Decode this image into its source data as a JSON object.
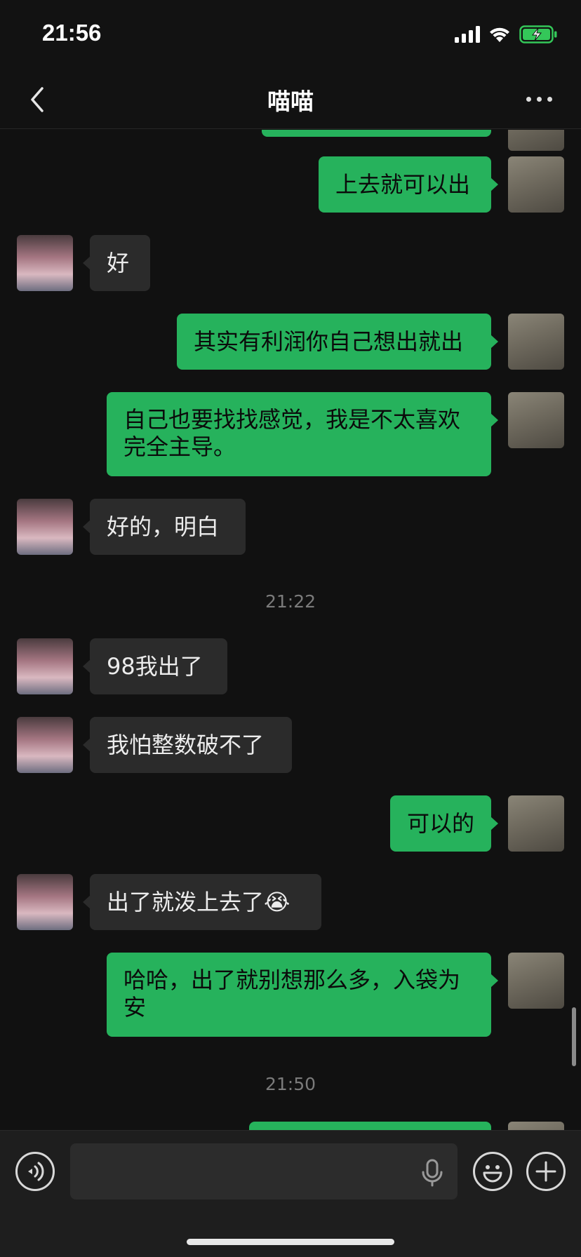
{
  "status_bar": {
    "time": "21:56",
    "battery_charging": true
  },
  "header": {
    "title": "喵喵"
  },
  "timestamps": {
    "t1": "21:22",
    "t2": "21:50"
  },
  "messages": {
    "m1": "上去就可以出",
    "m2": "好",
    "m3": "其实有利润你自己想出就出",
    "m4_line1": "自己也要找找感觉，我是不太喜欢",
    "m4_line2": "完全主导。",
    "m5": "好的，明白",
    "m6": "98我出了",
    "m7": "我怕整数破不了",
    "m8": "可以的",
    "m9": "出了就泼上去了",
    "m9_emoji": "😭",
    "m10_line1": "哈哈，出了就别想那么多，入袋为",
    "m10_line2": "安"
  },
  "input": {
    "placeholder": "",
    "value": ""
  },
  "colors": {
    "accent": "#26b25c",
    "background": "#111111",
    "incoming_bubble": "#2b2b2b"
  },
  "icons": [
    "chevron-left-icon",
    "more-icon",
    "signal-icon",
    "wifi-icon",
    "battery-icon",
    "voice-icon",
    "microphone-icon",
    "emoji-icon",
    "plus-icon"
  ]
}
